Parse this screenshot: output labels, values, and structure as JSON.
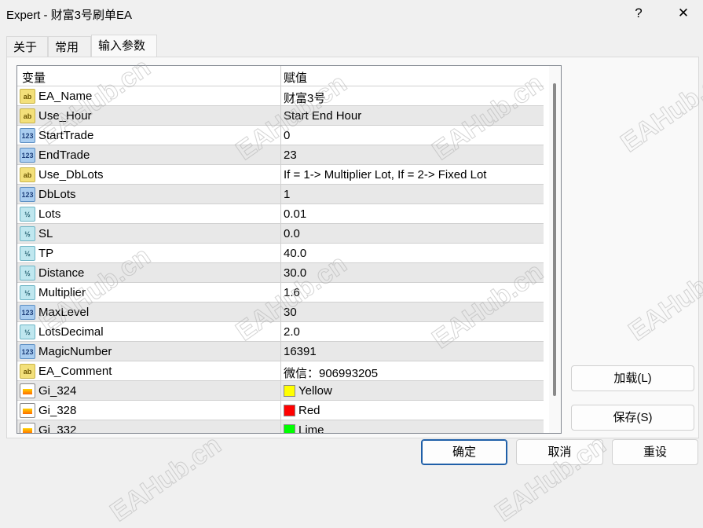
{
  "window": {
    "title": "Expert - 财富3号刷单EA",
    "help": "?",
    "close": "✕"
  },
  "tabs": [
    {
      "label": "关于"
    },
    {
      "label": "常用"
    },
    {
      "label": "输入参数"
    }
  ],
  "table": {
    "headers": [
      "变量",
      "赋值"
    ],
    "rows": [
      {
        "name": "EA_Name",
        "value": "财富3号",
        "type": "ab"
      },
      {
        "name": "Use_Hour",
        "value": "Start End Hour",
        "type": "ab"
      },
      {
        "name": "StartTrade",
        "value": "0",
        "type": "n"
      },
      {
        "name": "EndTrade",
        "value": "23",
        "type": "n"
      },
      {
        "name": "Use_DbLots",
        "value": "If = 1-> Multiplier Lot, If = 2-> Fixed Lot",
        "type": "ab"
      },
      {
        "name": "DbLots",
        "value": "1",
        "type": "n"
      },
      {
        "name": "Lots",
        "value": "0.01",
        "type": "f"
      },
      {
        "name": "SL",
        "value": "0.0",
        "type": "f"
      },
      {
        "name": "TP",
        "value": "40.0",
        "type": "f"
      },
      {
        "name": "Distance",
        "value": "30.0",
        "type": "f"
      },
      {
        "name": "Multiplier",
        "value": "1.6",
        "type": "f"
      },
      {
        "name": "MaxLevel",
        "value": "30",
        "type": "n"
      },
      {
        "name": "LotsDecimal",
        "value": "2.0",
        "type": "f"
      },
      {
        "name": "MagicNumber",
        "value": "16391",
        "type": "n"
      },
      {
        "name": "EA_Comment",
        "value": "微信：906993205",
        "type": "ab"
      },
      {
        "name": "Gi_324",
        "value": "Yellow",
        "type": "c",
        "color": "#ffff00"
      },
      {
        "name": "Gi_328",
        "value": "Red",
        "type": "c",
        "color": "#ff0000"
      },
      {
        "name": "Gi_332",
        "value": "Lime",
        "type": "c",
        "color": "#00ff00"
      }
    ]
  },
  "icon_labels": {
    "ab": "ab",
    "n": "123",
    "f": "½",
    "c": ""
  },
  "buttons": {
    "load": "加载(L)",
    "save": "保存(S)",
    "ok": "确定",
    "cancel": "取消",
    "reset": "重设"
  },
  "watermark": "EAHub.cn"
}
